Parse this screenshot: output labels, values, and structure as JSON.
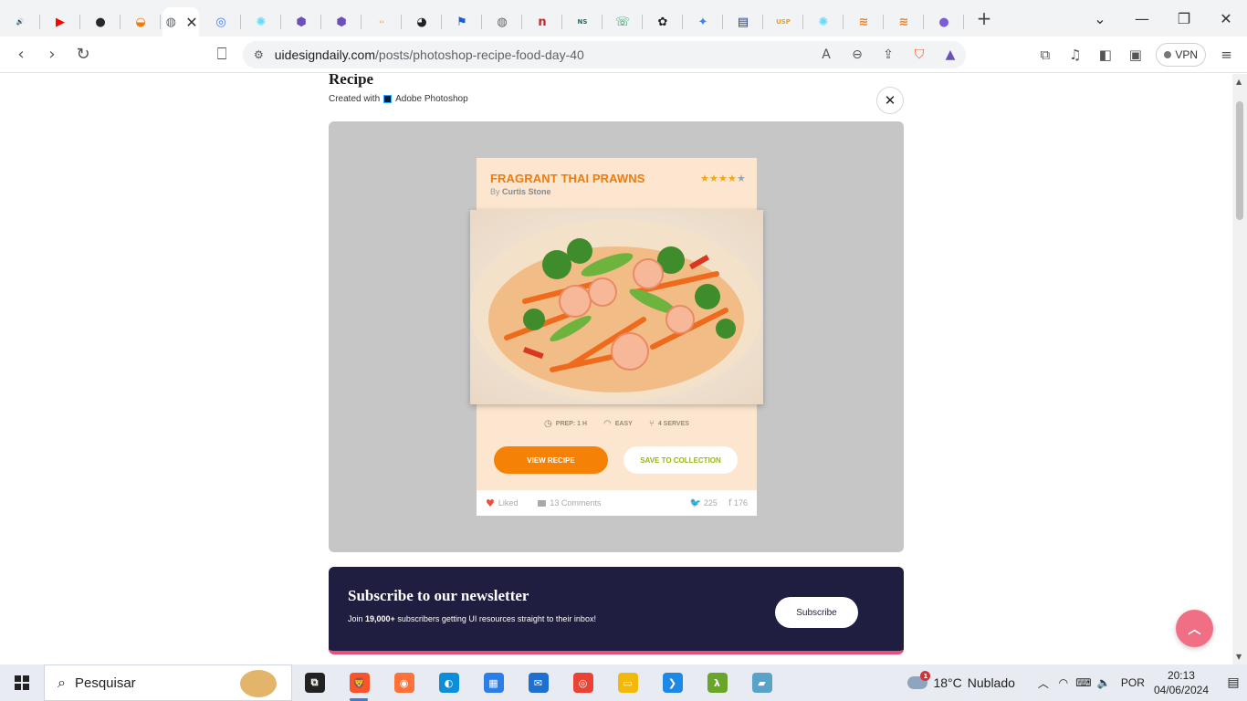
{
  "browser": {
    "tabs": [
      {
        "icon": "speaker-icon",
        "color": "#5f6368",
        "glyph": "🔊"
      },
      {
        "icon": "youtube-icon",
        "color": "#ff0000",
        "glyph": "▶"
      },
      {
        "icon": "github-icon",
        "color": "#24292e",
        "glyph": "●"
      },
      {
        "icon": "noodle-icon",
        "color": "#f07a0a",
        "glyph": "◒"
      },
      {
        "icon": "globe-icon",
        "color": "#5f6368",
        "glyph": "◍"
      },
      {
        "icon": "circle-app-icon",
        "color": "#3d7bfd",
        "glyph": "◎"
      },
      {
        "icon": "react-icon",
        "color": "#61dafb",
        "glyph": "✺"
      },
      {
        "icon": "hexagon-app-icon",
        "color": "#6b4fbb",
        "glyph": "⬢"
      },
      {
        "icon": "hexagon-app-icon",
        "color": "#6b4fbb",
        "glyph": "⬢"
      },
      {
        "icon": "code-icon",
        "color": "#f0a04b",
        "glyph": "‹›"
      },
      {
        "icon": "penguin-icon",
        "color": "#222222",
        "glyph": "◕"
      },
      {
        "icon": "flag-icon",
        "color": "#1a5fd0",
        "glyph": "⚑"
      },
      {
        "icon": "globe-icon",
        "color": "#5f6368",
        "glyph": "◍"
      },
      {
        "icon": "n-app-icon",
        "color": "#d6212b",
        "glyph": "n"
      },
      {
        "icon": "ns-app-icon",
        "color": "#0f766e",
        "glyph": "NS"
      },
      {
        "icon": "whatsapp-icon",
        "color": "#1f9e5a",
        "glyph": "☏"
      },
      {
        "icon": "openai-icon",
        "color": "#222222",
        "glyph": "✿"
      },
      {
        "icon": "sparkle-icon",
        "color": "#3b82f6",
        "glyph": "✦"
      },
      {
        "icon": "bookmark-app-icon",
        "color": "#1e3a8a",
        "glyph": "▤"
      },
      {
        "icon": "usp-icon",
        "color": "#f59e0b",
        "glyph": "USP"
      },
      {
        "icon": "react-icon",
        "color": "#61dafb",
        "glyph": "✺"
      },
      {
        "icon": "stackoverflow-icon",
        "color": "#f48024",
        "glyph": "≋"
      },
      {
        "icon": "stackoverflow-icon",
        "color": "#f48024",
        "glyph": "≋"
      },
      {
        "icon": "planet-icon",
        "color": "#7c5cd6",
        "glyph": "●"
      }
    ],
    "active_tab_index": 4,
    "url_host": "uidesigndaily.com",
    "url_path": "/posts/photoshop-recipe-food-day-40",
    "vpn_label": "VPN"
  },
  "page": {
    "heading": "Recipe",
    "created_with": "Created with",
    "tool_name": "Adobe Photoshop",
    "close_glyph": "✕"
  },
  "card": {
    "title": "FRAGRANT THAI PRAWNS",
    "by_prefix": "By",
    "author": "Curtis Stone",
    "rating": 4,
    "rating_max": 5,
    "meta": [
      {
        "icon": "clock-icon",
        "glyph": "◷",
        "label": "PREP: 1 H"
      },
      {
        "icon": "chef-hat-icon",
        "glyph": "◠",
        "label": "EASY"
      },
      {
        "icon": "cutlery-icon",
        "glyph": "⑂",
        "label": "4 SERVES"
      }
    ],
    "view_label": "VIEW RECIPE",
    "save_label": "SAVE TO COLLECTION",
    "liked_label": "Liked",
    "comments_label": "13 Comments",
    "twitter_count": "225",
    "facebook_count": "176",
    "colors": {
      "accent": "#f58207",
      "save_text": "#9ab512",
      "card_bg": "#fde6cf"
    }
  },
  "newsletter": {
    "title": "Subscribe to our newsletter",
    "text_prefix": "Join",
    "count": "19,000+",
    "text_suffix": "subscribers getting UI resources straight to their inbox!",
    "button_label": "Subscribe",
    "colors": {
      "bg": "#1f1d40",
      "accent": "#e7507a"
    }
  },
  "taskbar": {
    "search_placeholder": "Pesquisar",
    "apps": [
      {
        "icon": "task-view-icon",
        "color": "#222222",
        "glyph": "⧉"
      },
      {
        "icon": "brave-icon",
        "color": "#fb542b",
        "glyph": "🦁"
      },
      {
        "icon": "firefox-icon",
        "color": "#ff7139",
        "glyph": "◉"
      },
      {
        "icon": "edge-icon",
        "color": "#0c8ed9",
        "glyph": "◐"
      },
      {
        "icon": "store-icon",
        "color": "#2b7de9",
        "glyph": "▦"
      },
      {
        "icon": "mail-icon",
        "color": "#1f6fd0",
        "glyph": "✉"
      },
      {
        "icon": "chrome-icon",
        "color": "#ea4335",
        "glyph": "◎"
      },
      {
        "icon": "file-explorer-icon",
        "color": "#f2b90c",
        "glyph": "▭"
      },
      {
        "icon": "vscode-icon",
        "color": "#1e88e5",
        "glyph": "❯"
      },
      {
        "icon": "lambda-app-icon",
        "color": "#6aa52b",
        "glyph": "λ"
      },
      {
        "icon": "notes-app-icon",
        "color": "#5aa3c8",
        "glyph": "▰"
      }
    ],
    "active_app_index": 1,
    "weather_temp": "18°C",
    "weather_text": "Nublado",
    "weather_badge": "1",
    "language": "POR",
    "time": "20:13",
    "date": "04/06/2024"
  }
}
